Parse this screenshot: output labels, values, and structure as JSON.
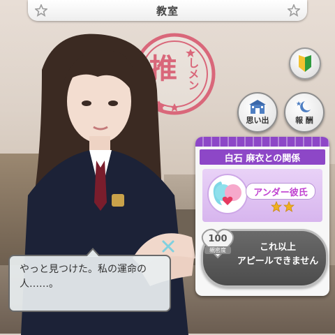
{
  "header": {
    "title": "教室"
  },
  "stamp": {
    "text_main": "推",
    "text_sub": "しメン"
  },
  "buttons": {
    "memories_label": "思い出",
    "reward_label": "報 酬"
  },
  "relationship": {
    "title": "白石 麻衣との関係",
    "status": "アンダー彼氏",
    "stars_filled": 2
  },
  "appeal": {
    "intimacy_value": "100",
    "intimacy_label": "親密度",
    "button_text": "これ以上\nアピールできません"
  },
  "dialogue": {
    "text": "やっと見つけた。私の運命の人……。"
  },
  "colors": {
    "accent_purple": "#8d47c7",
    "stamp_red": "#d9677a",
    "header_star": "#9c9c9c"
  }
}
